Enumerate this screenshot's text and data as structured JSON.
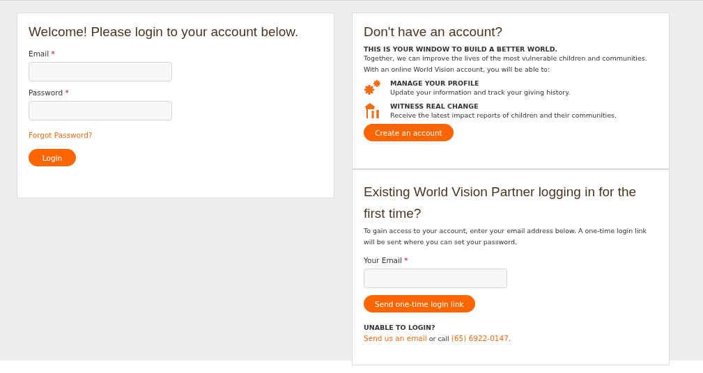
{
  "login": {
    "title": "Welcome! Please login to your account below.",
    "fields": [
      {
        "label": "Email",
        "required_mark": "*"
      },
      {
        "label": "Password",
        "required_mark": "*"
      }
    ],
    "forgot_link": "Forgot Password?",
    "button": "Login"
  },
  "signup": {
    "title": "Don't have an account?",
    "tagline": "THIS IS YOUR WINDOW TO BUILD A BETTER WORLD.",
    "intro": [
      "Together, we can improve the lives of the most vulnerable children and communities.",
      "With an online World Vision account, you will be able to:"
    ],
    "features": [
      {
        "kind": "gears",
        "heading": "MANAGE YOUR PROFILE",
        "text": "Update your information and track your giving history."
      },
      {
        "kind": "community",
        "heading": "WITNESS REAL CHANGE",
        "text": "Receive the latest impact reports of children and their communities."
      }
    ],
    "button": "Create an account"
  },
  "first_time": {
    "title": "Existing World Vision Partner logging in for the first time?",
    "description": "To gain access to your account, enter your email address below. A one-time login link will be sent where you can set your password.",
    "field": {
      "label": "Your Email",
      "required_mark": "*"
    },
    "button": "Send one-time login link",
    "help_heading": "UNABLE TO LOGIN?",
    "help_parts": [
      {
        "kind": "link",
        "text": "Send us an email"
      },
      {
        "kind": "text",
        "text": " or call "
      },
      {
        "kind": "link",
        "text": "(65) 6922-0147"
      },
      {
        "kind": "text",
        "text": "."
      }
    ]
  }
}
